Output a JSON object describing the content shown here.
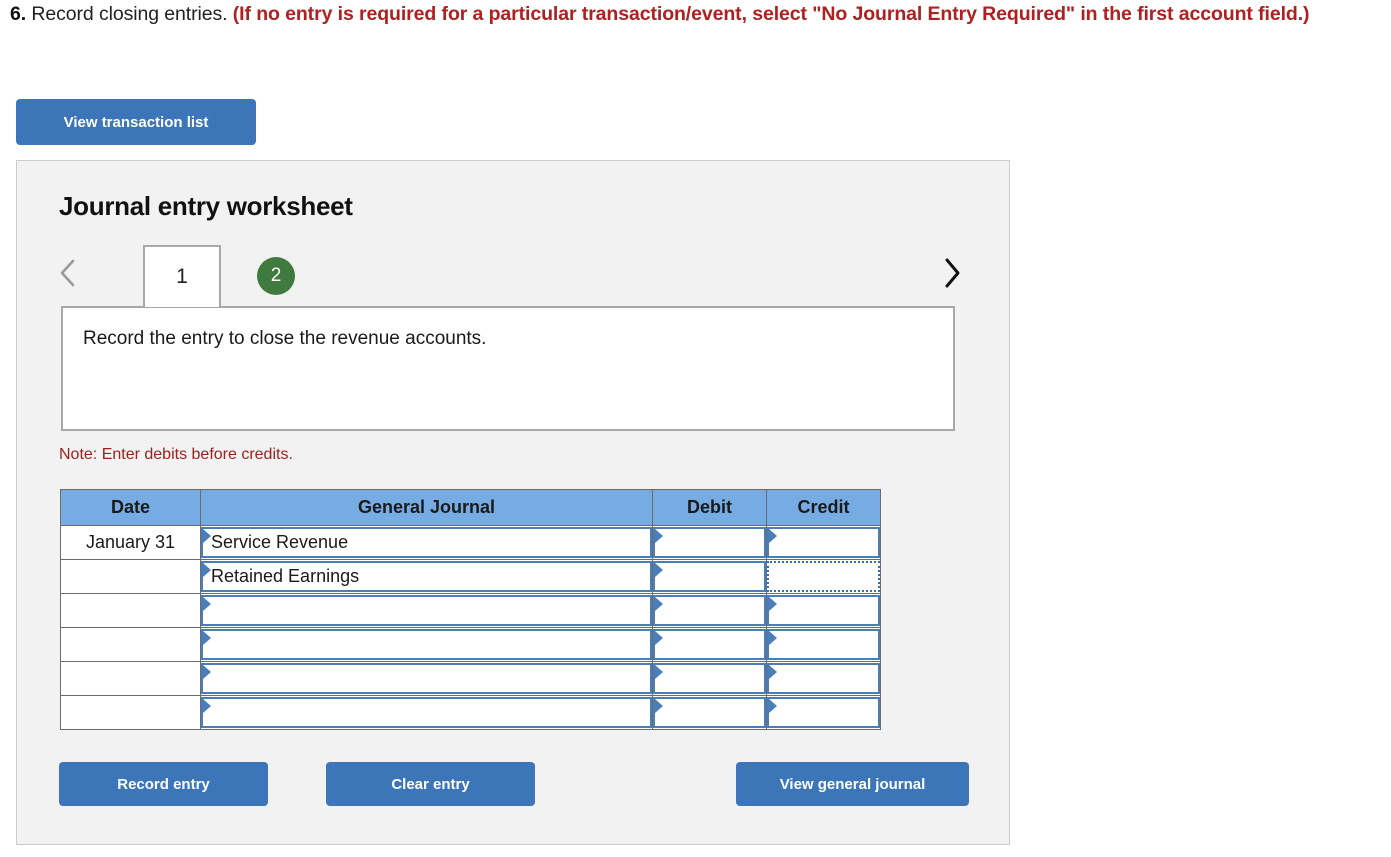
{
  "prompt": {
    "number": "6.",
    "text": " Record closing entries. ",
    "red_note": "(If no entry is required for a particular transaction/event, select \"No Journal Entry Required\" in the first account field.)"
  },
  "toolbar": {
    "view_transaction_list": "View transaction list"
  },
  "worksheet": {
    "title": "Journal entry worksheet",
    "prev_label": "‹",
    "next_label": "›",
    "tabs": [
      {
        "label": "1",
        "state": "active"
      },
      {
        "label": "2",
        "state": "complete"
      }
    ],
    "instruction": "Record the entry to close the revenue accounts.",
    "note": "Note: Enter debits before credits."
  },
  "journal": {
    "columns": [
      "Date",
      "General Journal",
      "Debit",
      "Credit"
    ],
    "rows": [
      {
        "date": "January 31",
        "account": "Service Revenue",
        "debit": "",
        "credit": "",
        "focus": ""
      },
      {
        "date": "",
        "account": "Retained Earnings",
        "debit": "",
        "credit": "",
        "focus": "credit"
      },
      {
        "date": "",
        "account": "",
        "debit": "",
        "credit": "",
        "focus": ""
      },
      {
        "date": "",
        "account": "",
        "debit": "",
        "credit": "",
        "focus": ""
      },
      {
        "date": "",
        "account": "",
        "debit": "",
        "credit": "",
        "focus": ""
      },
      {
        "date": "",
        "account": "",
        "debit": "",
        "credit": "",
        "focus": ""
      }
    ]
  },
  "footer": {
    "record_entry": "Record entry",
    "clear_entry": "Clear entry",
    "view_general_journal": "View general journal"
  },
  "colors": {
    "button_blue": "#3c76b8",
    "header_blue": "#76abe3",
    "tab_green": "#3f7a3f",
    "red_text": "#b02020",
    "note_red": "#9d2020",
    "panel_bg": "#f2f2f2",
    "cell_border_blue": "#4a7ebb"
  }
}
